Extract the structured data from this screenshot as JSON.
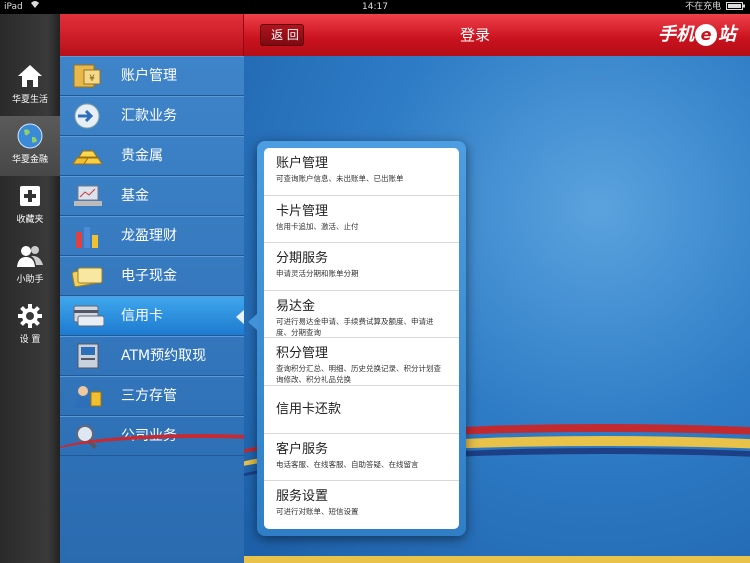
{
  "statusbar": {
    "carrier": "iPad",
    "time": "14:17",
    "charging": "不在充电"
  },
  "dock": {
    "items": [
      {
        "label": "华夏生活",
        "icon": "home-icon"
      },
      {
        "label": "华夏金融",
        "icon": "globe-icon",
        "active": true
      },
      {
        "label": "收藏夹",
        "icon": "plus-icon"
      },
      {
        "label": "小助手",
        "icon": "people-icon"
      },
      {
        "label": "设 置",
        "icon": "gear-icon"
      }
    ]
  },
  "header": {
    "back_label": "返 回",
    "title": "登录",
    "brand_pre": "手机",
    "brand_e": "e",
    "brand_post": "站"
  },
  "menu": {
    "items": [
      {
        "label": "账户管理",
        "icon": "account-icon"
      },
      {
        "label": "汇款业务",
        "icon": "remittance-icon"
      },
      {
        "label": "贵金属",
        "icon": "gold-bars-icon"
      },
      {
        "label": "基金",
        "icon": "fund-icon"
      },
      {
        "label": "龙盈理财",
        "icon": "wealth-icon"
      },
      {
        "label": "电子现金",
        "icon": "cash-card-icon"
      },
      {
        "label": "信用卡",
        "icon": "credit-card-icon",
        "active": true
      },
      {
        "label": "ATM预约取现",
        "icon": "atm-icon"
      },
      {
        "label": "三方存管",
        "icon": "custody-icon"
      },
      {
        "label": "公司业务",
        "icon": "business-icon"
      }
    ]
  },
  "popover": {
    "items": [
      {
        "title": "账户管理",
        "desc": "可查询账户信息、未出账单、已出账单"
      },
      {
        "title": "卡片管理",
        "desc": "信用卡追加、激活、止付"
      },
      {
        "title": "分期服务",
        "desc": "申请灵活分期和账单分期"
      },
      {
        "title": "易达金",
        "desc": "可进行易达金申请、手续费试算及额度、申请进度、分期查询"
      },
      {
        "title": "积分管理",
        "desc": "查询积分汇总、明细、历史兑换记录、积分计划查询修改、积分礼品兑换"
      },
      {
        "title": "信用卡还款",
        "desc": ""
      },
      {
        "title": "客户服务",
        "desc": "电话客服、在线客服、自助答疑、在线留言"
      },
      {
        "title": "服务设置",
        "desc": "可进行对账单、短信设置"
      }
    ]
  },
  "colors": {
    "header_red": "#c8121e",
    "menu_blue": "#2a6bb0",
    "active_blue": "#1d7bd0"
  }
}
